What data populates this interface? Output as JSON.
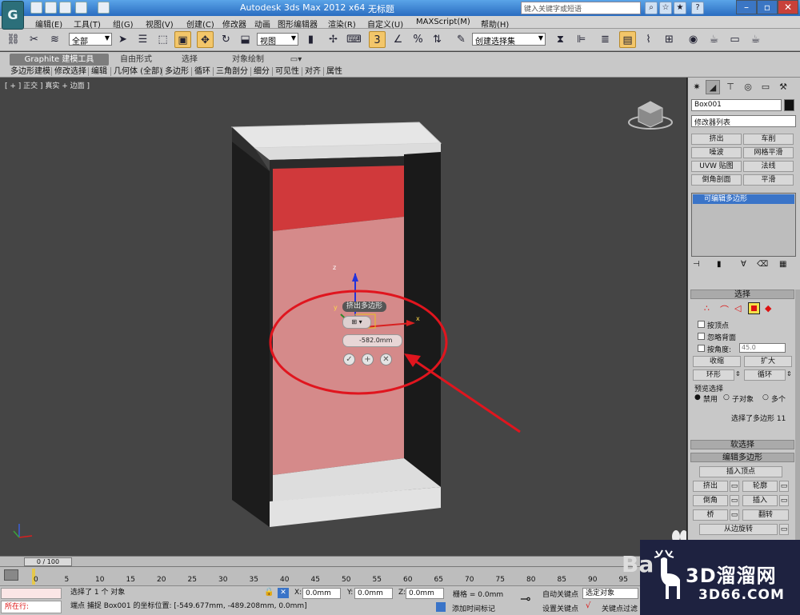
{
  "app": {
    "title": "Autodesk 3ds Max  2012 x64",
    "file_name": "无标题",
    "search_placeholder": "键入关键字或短语",
    "logo_letter": "G"
  },
  "menu": [
    "编辑(E)",
    "工具(T)",
    "组(G)",
    "视图(V)",
    "创建(C)",
    "修改器",
    "动画",
    "图形编辑器",
    "渲染(R)",
    "自定义(U)",
    "MAXScript(M)",
    "帮助(H)"
  ],
  "toolbar": {
    "selection_filter": "全部",
    "ref_coord": "视图",
    "named_selection": "创建选择集"
  },
  "ribbon": {
    "tabs": [
      "Graphite 建模工具",
      "自由形式",
      "选择",
      "对象绘制"
    ],
    "buttons": [
      "多边形建模",
      "修改选择",
      "编辑",
      "几何体 (全部)",
      "多边形",
      "循环",
      "三角剖分",
      "细分",
      "可见性",
      "对齐",
      "属性"
    ]
  },
  "viewport": {
    "label": "[ + ] 正交 ] 真实 + 边面 ]",
    "caddy_title": "挤出多边形",
    "caddy_value": "-582.0mm",
    "axis_x": "x",
    "axis_y": "y",
    "axis_z": "z"
  },
  "panel": {
    "object_name": "Box001",
    "modifier_list": "修改器列表",
    "modifier_buttons": [
      "挤出",
      "车削",
      "噪波",
      "网格平滑",
      "UVW 贴图",
      "法线",
      "倒角剖面",
      "平滑"
    ],
    "stack_item": "可编辑多边形",
    "selection": {
      "title": "选择",
      "by_vertex": "按顶点",
      "ignore_backfacing": "忽略背面",
      "by_angle": "按角度:",
      "angle_value": "45.0",
      "shrink": "收缩",
      "grow": "扩大",
      "ring": "环形",
      "loop": "循环",
      "preview_title": "预览选择",
      "preview_options": [
        "禁用",
        "子对象",
        "多个"
      ],
      "status": "选择了多边形 11"
    },
    "soft_selection": "软选择",
    "edit_polygons": {
      "title": "编辑多边形",
      "insert_vertex": "插入顶点",
      "buttons": [
        "挤出",
        "轮廓",
        "倒角",
        "插入",
        "桥",
        "翻转"
      ],
      "hinge": "从边旋转"
    }
  },
  "timeline": {
    "frame": "0 / 100",
    "ticks": [
      "0",
      "5",
      "10",
      "15",
      "20",
      "25",
      "30",
      "35",
      "40",
      "45",
      "50",
      "55",
      "60",
      "65",
      "70",
      "75",
      "80",
      "85",
      "90",
      "95"
    ]
  },
  "status": {
    "script_text": "所在行:",
    "selected": "选择了 1 个 对象",
    "prompt": "端点 捕捉 Box001 的坐标位置: [-549.677mm, -489.208mm, 0.0mm]",
    "x_label": "X:",
    "x_value": "0.0mm",
    "y_label": "Y:",
    "y_value": "0.0mm",
    "z_label": "Z:",
    "z_value": "0.0mm",
    "grid": "栅格 = 0.0mm",
    "add_time_tag": "添加时间标记",
    "auto_key": "自动关键点",
    "selected_object": "选定对象",
    "set_key": "设置关键点",
    "key_filters": "关键点过滤"
  },
  "watermark": {
    "bai": "Ba",
    "brand": "3D溜溜网",
    "url": "3D66.COM"
  },
  "colors": {
    "viewport_bg": "#454545",
    "selected_face": "#d98a8a",
    "annotation": "#e0151e",
    "gizmo_active": "#f3c66a"
  }
}
